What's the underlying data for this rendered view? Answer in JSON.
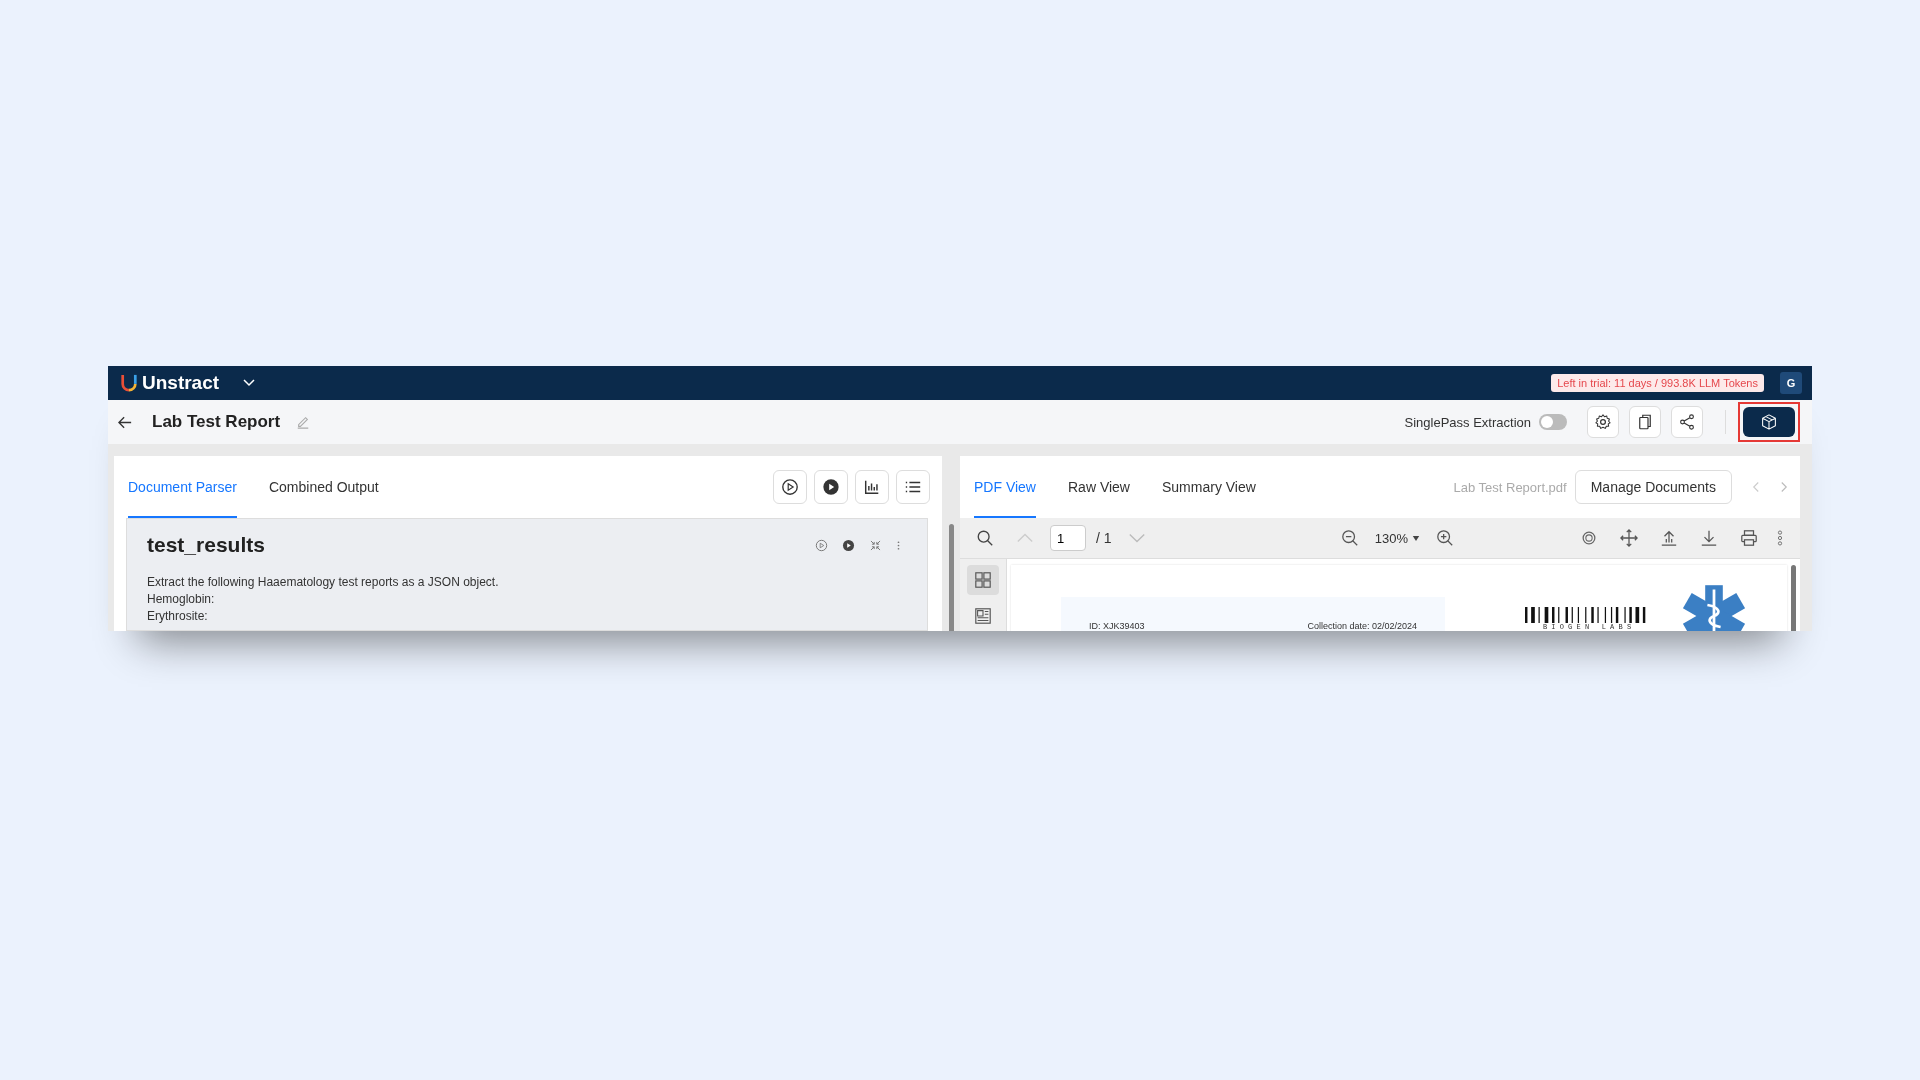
{
  "topbar": {
    "brand": "Unstract",
    "trial_badge": "Left in trial: 11 days / 993.8K LLM Tokens",
    "avatar": "G"
  },
  "header": {
    "title": "Lab Test Report",
    "singlepass": {
      "label": "SinglePass Extraction",
      "on": false
    },
    "export_highlighted": true
  },
  "left": {
    "tabs": [
      {
        "label": "Document Parser",
        "selected": true
      },
      {
        "label": "Combined Output",
        "selected": false
      }
    ],
    "prompt": {
      "title": "test_results",
      "lines": [
        "Extract the following Haaematology test reports as a JSON object.",
        "Hemoglobin:",
        "Erythrosite:"
      ]
    }
  },
  "right": {
    "tabs": [
      {
        "label": "PDF View",
        "selected": true
      },
      {
        "label": "Raw View",
        "selected": false
      },
      {
        "label": "Summary View",
        "selected": false
      }
    ],
    "file_name": "Lab Test Report.pdf",
    "manage_button": "Manage Documents",
    "toolbar": {
      "page": "1",
      "page_total": "/ 1",
      "zoom": "130%"
    },
    "sidebar_tools": [
      {
        "kind": "thumbnails",
        "selected": true
      },
      {
        "kind": "outline",
        "selected": false
      }
    ],
    "document": {
      "id": "ID: XJK39403",
      "collection_date": "Collection date: 02/02/2024",
      "lab_name": "B I O G E N   L A B S"
    }
  }
}
